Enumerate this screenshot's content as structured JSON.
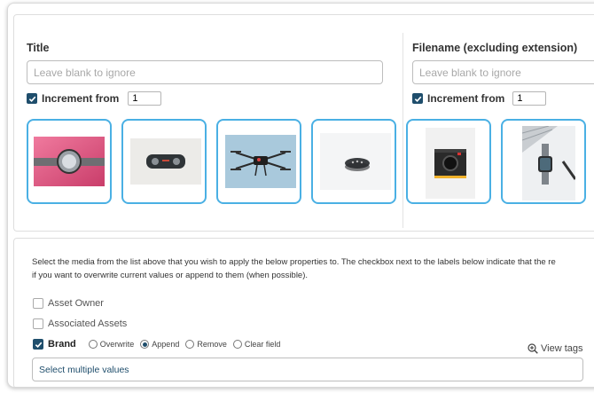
{
  "title_field": {
    "label": "Title",
    "placeholder": "Leave blank to ignore",
    "increment_label": "Increment from",
    "increment_value": "1",
    "increment_checked": true
  },
  "filename_field": {
    "label": "Filename (excluding extension)",
    "placeholder": "Leave blank to ignore",
    "increment_label": "Increment from",
    "increment_value": "1",
    "increment_checked": true
  },
  "media": [
    {
      "subject": "wristwatch-photo"
    },
    {
      "subject": "game-controller-photo"
    },
    {
      "subject": "drone-photo"
    },
    {
      "subject": "smart-speaker-photo"
    },
    {
      "subject": "instant-camera-photo"
    },
    {
      "subject": "laptop-smartwatch-photo"
    }
  ],
  "instructions": {
    "line1": "Select the media from the list above that you wish to apply the below properties to. The checkbox next to the labels below indicate that the re",
    "line2": "if you want to overwrite current values or append to them (when possible)."
  },
  "properties": [
    {
      "label": "Asset Owner",
      "checked": false
    },
    {
      "label": "Associated Assets",
      "checked": false
    },
    {
      "label": "Brand",
      "checked": true
    }
  ],
  "brand_modes": {
    "options": [
      "Overwrite",
      "Append",
      "Remove",
      "Clear field"
    ],
    "selected": "Append"
  },
  "view_tags_label": "View tags",
  "multi_select_text": "Select multiple values",
  "colors": {
    "accent": "#1f4e6c",
    "thumb_border": "#4ab0e4"
  }
}
